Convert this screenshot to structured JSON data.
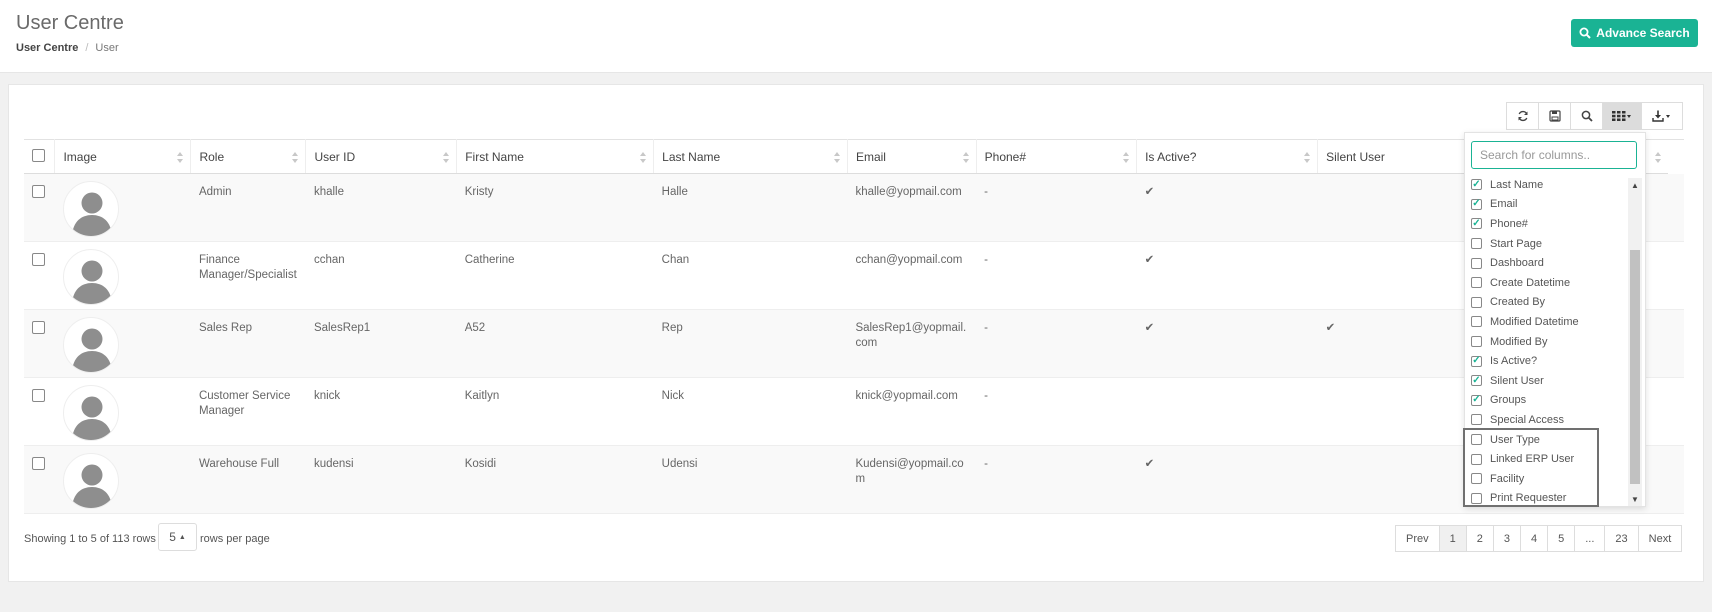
{
  "header": {
    "title": "User Centre",
    "breadcrumb": [
      "User Centre",
      "User"
    ],
    "breadcrumb_separator": "/",
    "advance_search_label": "Advance Search"
  },
  "toolbar": {
    "icons": [
      "refresh-icon",
      "save-icon",
      "search-icon",
      "columns-icon",
      "export-icon"
    ]
  },
  "table": {
    "columns": [
      "Image",
      "Role",
      "User ID",
      "First Name",
      "Last Name",
      "Email",
      "Phone#",
      "Is Active?",
      "Silent User"
    ],
    "rows": [
      {
        "role": "Admin",
        "user_id": "khalle",
        "first_name": "Kristy",
        "last_name": "Halle",
        "email": "khalle@yopmail.com",
        "phone": "-",
        "is_active": "✔",
        "silent_user": ""
      },
      {
        "role": "Finance Manager/Specialist",
        "user_id": "cchan",
        "first_name": "Catherine",
        "last_name": "Chan",
        "email": "cchan@yopmail.com",
        "phone": "-",
        "is_active": "✔",
        "silent_user": ""
      },
      {
        "role": "Sales Rep",
        "user_id": "SalesRep1",
        "first_name": "A52",
        "last_name": "Rep",
        "email": "SalesRep1@yopmail.com",
        "phone": "-",
        "is_active": "✔",
        "silent_user": "✔"
      },
      {
        "role": "Customer Service Manager",
        "user_id": "knick",
        "first_name": "Kaitlyn",
        "last_name": "Nick",
        "email": "knick@yopmail.com",
        "phone": "-",
        "is_active": "",
        "silent_user": ""
      },
      {
        "role": "Warehouse Full",
        "user_id": "kudensi",
        "first_name": "Kosidi",
        "last_name": "Udensi",
        "email": "Kudensi@yopmail.com",
        "phone": "-",
        "is_active": "✔",
        "silent_user": ""
      }
    ]
  },
  "footer": {
    "showing_text": "Showing 1 to 5 of 113 rows",
    "page_size": "5",
    "rows_per_page_label": "rows per page",
    "pager": [
      "Prev",
      "1",
      "2",
      "3",
      "4",
      "5",
      "...",
      "23",
      "Next"
    ],
    "active_page": "1"
  },
  "column_picker": {
    "search_placeholder": "Search for columns..",
    "items": [
      {
        "label": "Last Name",
        "checked": true
      },
      {
        "label": "Email",
        "checked": true
      },
      {
        "label": "Phone#",
        "checked": true
      },
      {
        "label": "Start Page",
        "checked": false
      },
      {
        "label": "Dashboard",
        "checked": false
      },
      {
        "label": "Create Datetime",
        "checked": false
      },
      {
        "label": "Created By",
        "checked": false
      },
      {
        "label": "Modified Datetime",
        "checked": false
      },
      {
        "label": "Modified By",
        "checked": false
      },
      {
        "label": "Is Active?",
        "checked": true
      },
      {
        "label": "Silent User",
        "checked": true
      },
      {
        "label": "Groups",
        "checked": true
      },
      {
        "label": "Special Access",
        "checked": false
      },
      {
        "label": "User Type",
        "checked": false
      },
      {
        "label": "Linked ERP User",
        "checked": false
      },
      {
        "label": "Facility",
        "checked": false
      },
      {
        "label": "Print Requester",
        "checked": false
      }
    ]
  },
  "colors": {
    "accent": "#1ab394",
    "header_bg": "#ffffff",
    "page_bg": "#f1f1f1",
    "highlight_border": "#707070"
  }
}
